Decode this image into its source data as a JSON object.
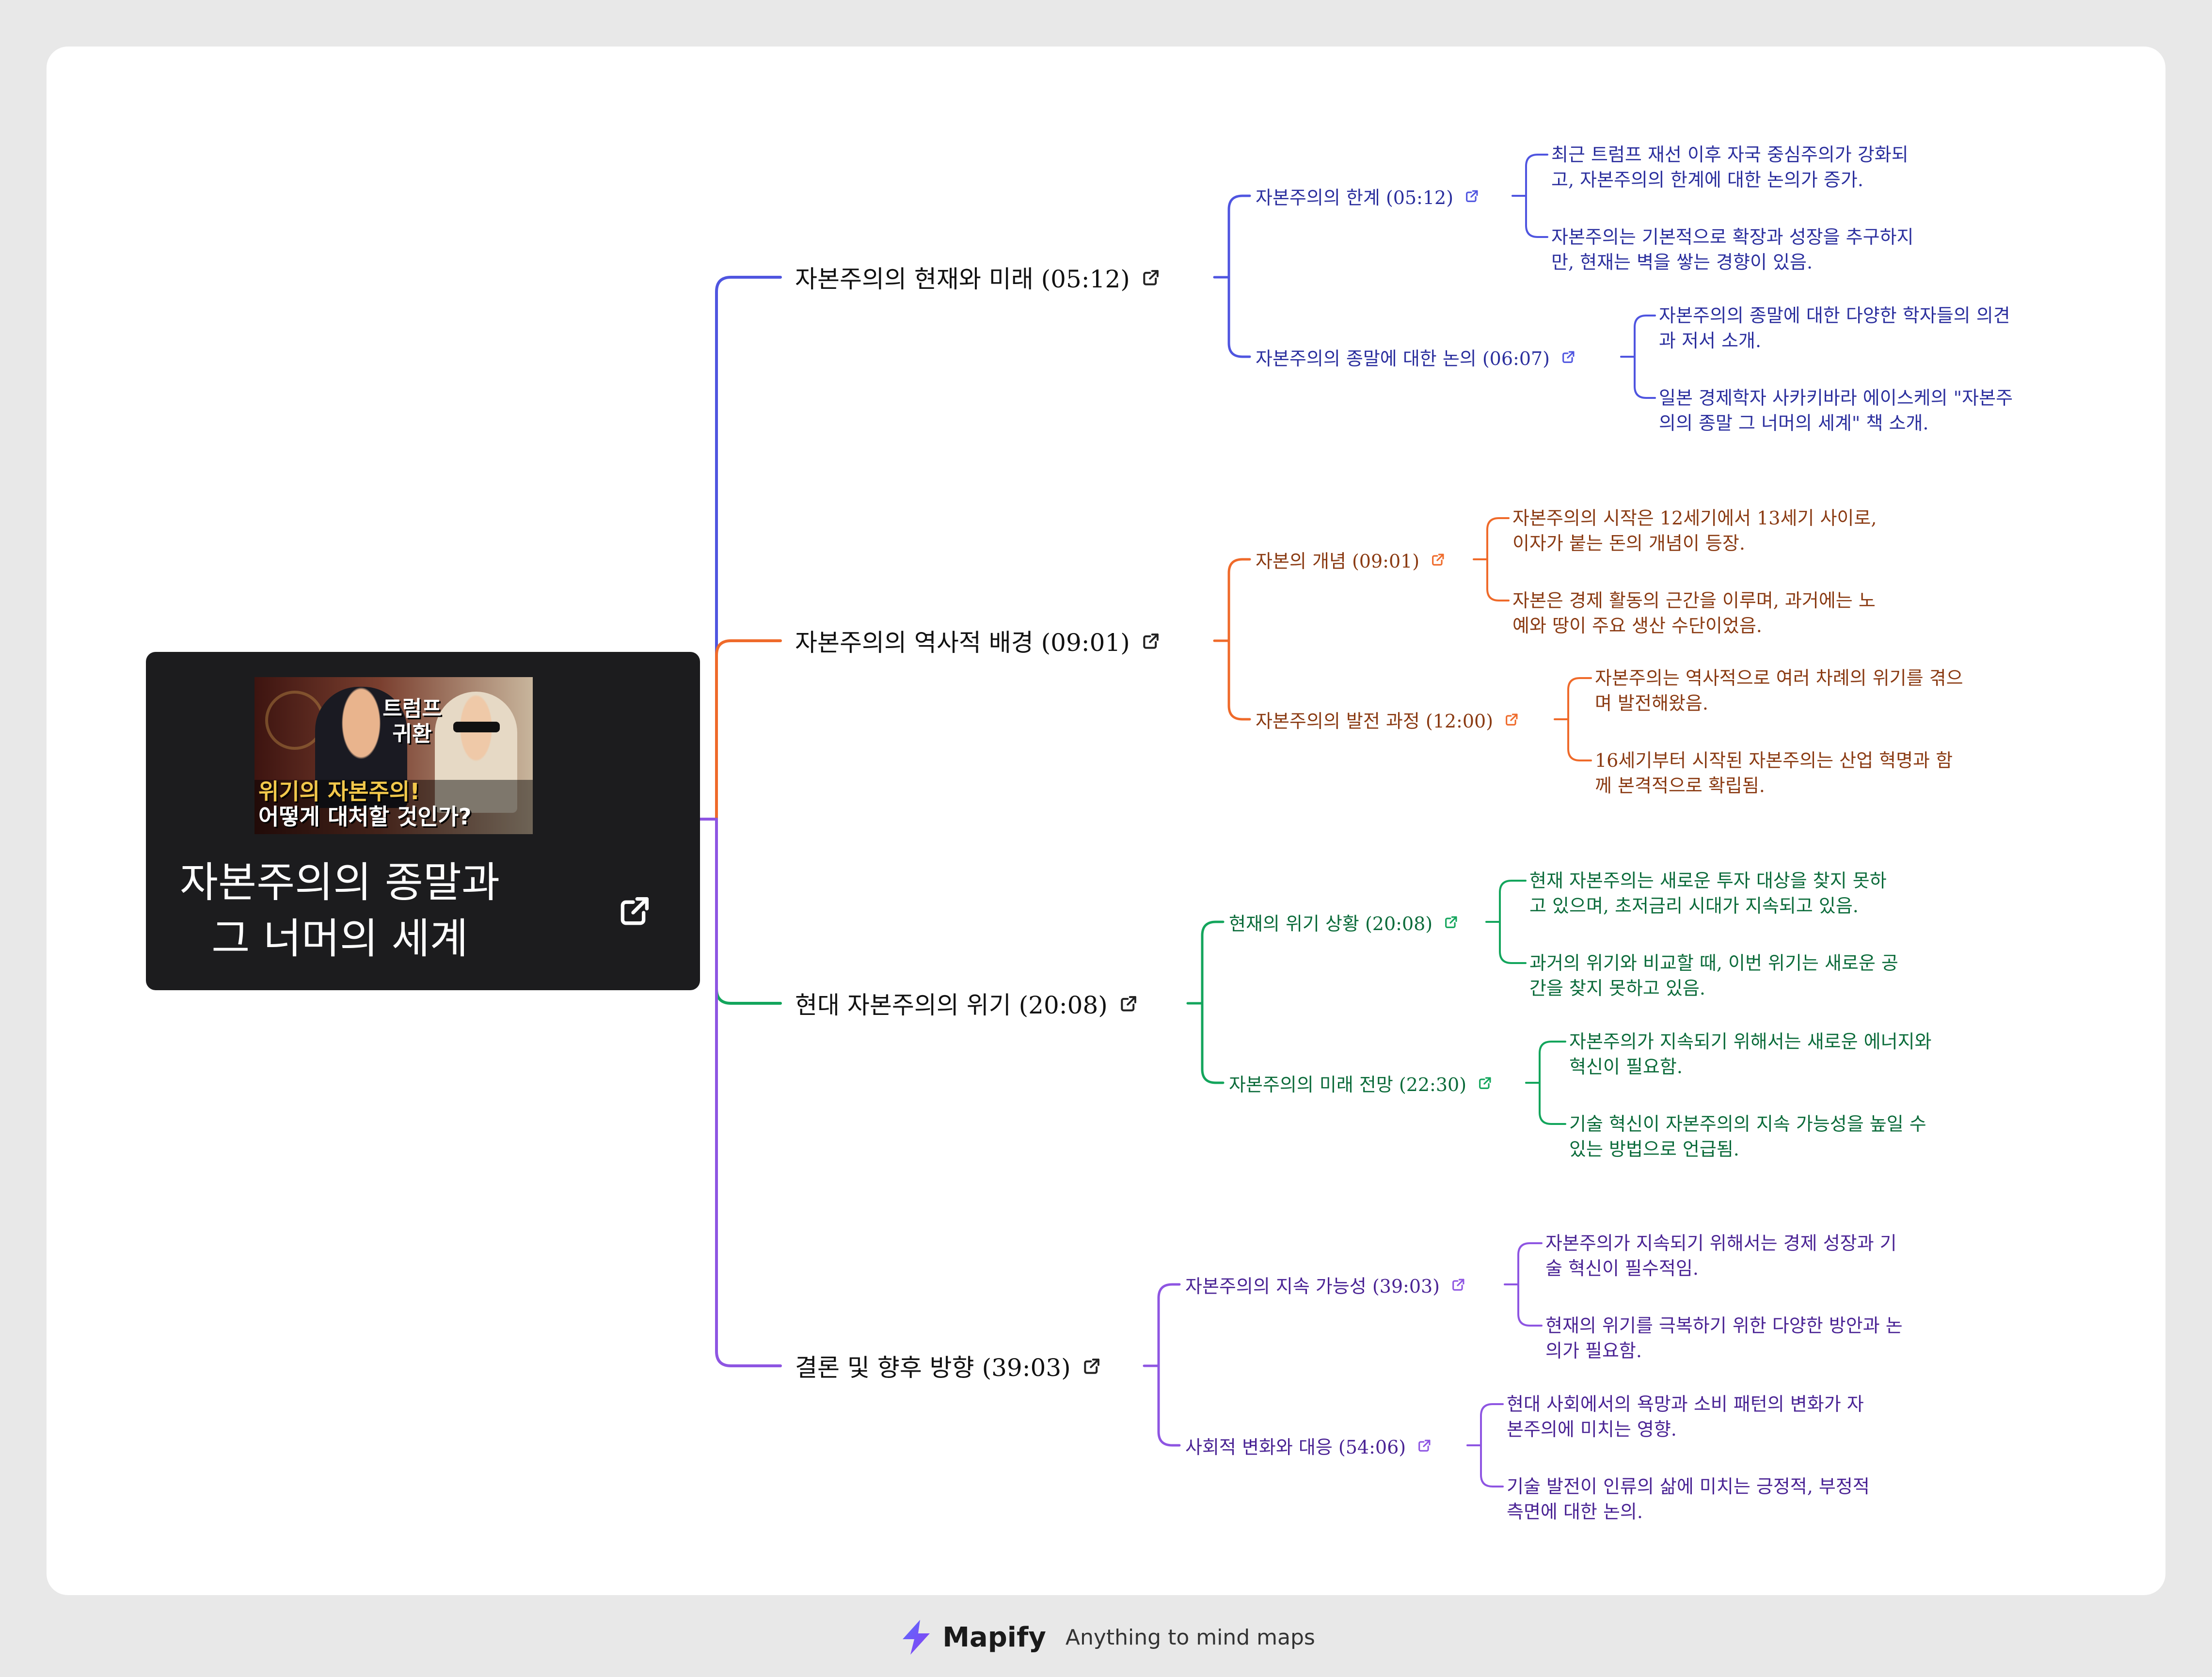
{
  "root": {
    "title": "자본주의의 종말과 그 너머의 세계",
    "thumbnail": {
      "top_text": "트럼프 귀환",
      "line1": "위기의 자본주의!",
      "line2": "어떻게 대처할 것인가?"
    }
  },
  "branches": [
    {
      "label": "자본주의의 현재와 미래 (05:12)",
      "color": "#4f55e0",
      "text_color": "#2b2f9e",
      "children": [
        {
          "label": "자본주의의 한계 (05:12)",
          "leaves": [
            [
              "최근 트럼프 재선 이후 자국 중심주의가 강화되",
              "고, 자본주의의 한계에 대한 논의가 증가."
            ],
            [
              "자본주의는 기본적으로 확장과 성장을 추구하지",
              "만, 현재는 벽을 쌓는 경향이 있음."
            ]
          ]
        },
        {
          "label": "자본주의의 종말에 대한 논의 (06:07)",
          "leaves": [
            [
              "자본주의의 종말에 대한 다양한 학자들의 의견",
              "과 저서 소개."
            ],
            [
              "일본 경제학자 사카키바라 에이스케의 \"자본주",
              "의의 종말 그 너머의 세계\" 책 소개."
            ]
          ]
        }
      ]
    },
    {
      "label": "자본주의의 역사적 배경 (09:01)",
      "color": "#ef6a2a",
      "text_color": "#8a3a12",
      "children": [
        {
          "label": "자본의 개념 (09:01)",
          "leaves": [
            [
              "자본주의의 시작은 12세기에서 13세기 사이로,",
              "이자가 붙는 돈의 개념이 등장."
            ],
            [
              "자본은 경제 활동의 근간을 이루며, 과거에는 노",
              "예와 땅이 주요 생산 수단이었음."
            ]
          ]
        },
        {
          "label": "자본주의의 발전 과정 (12:00)",
          "leaves": [
            [
              "자본주의는 역사적으로 여러 차례의 위기를 겪으",
              "며 발전해왔음."
            ],
            [
              "16세기부터 시작된 자본주의는 산업 혁명과 함",
              "께 본격적으로 확립됨."
            ]
          ]
        }
      ]
    },
    {
      "label": "현대 자본주의의 위기 (20:08)",
      "color": "#13a55c",
      "text_color": "#0b6b3a",
      "children": [
        {
          "label": "현재의 위기 상황 (20:08)",
          "leaves": [
            [
              "현재 자본주의는 새로운 투자 대상을 찾지 못하",
              "고 있으며, 초저금리 시대가 지속되고 있음."
            ],
            [
              "과거의 위기와 비교할 때, 이번 위기는 새로운 공",
              "간을 찾지 못하고 있음."
            ]
          ]
        },
        {
          "label": "자본주의의 미래 전망 (22:30)",
          "leaves": [
            [
              "자본주의가 지속되기 위해서는 새로운 에너지와",
              "혁신이 필요함."
            ],
            [
              "기술 혁신이 자본주의의 지속 가능성을 높일 수",
              "있는 방법으로 언급됨."
            ]
          ]
        }
      ]
    },
    {
      "label": "결론 및 향후 방향 (39:03)",
      "color": "#8e55e2",
      "text_color": "#4a2394",
      "children": [
        {
          "label": "자본주의의 지속 가능성 (39:03)",
          "leaves": [
            [
              "자본주의가 지속되기 위해서는 경제 성장과 기",
              "술 혁신이 필수적임."
            ],
            [
              "현재의 위기를 극복하기 위한 다양한 방안과 논",
              "의가 필요함."
            ]
          ]
        },
        {
          "label": "사회적 변화와 대응 (54:06)",
          "leaves": [
            [
              "현대 사회에서의 욕망과 소비 패턴의 변화가 자",
              "본주의에 미치는 영향."
            ],
            [
              "기술 발전이 인류의 삶에 미치는 긍정적, 부정적",
              "측면에 대한 논의."
            ]
          ]
        }
      ]
    }
  ],
  "footer": {
    "brand": "Mapify",
    "tagline": "Anything to mind maps"
  }
}
